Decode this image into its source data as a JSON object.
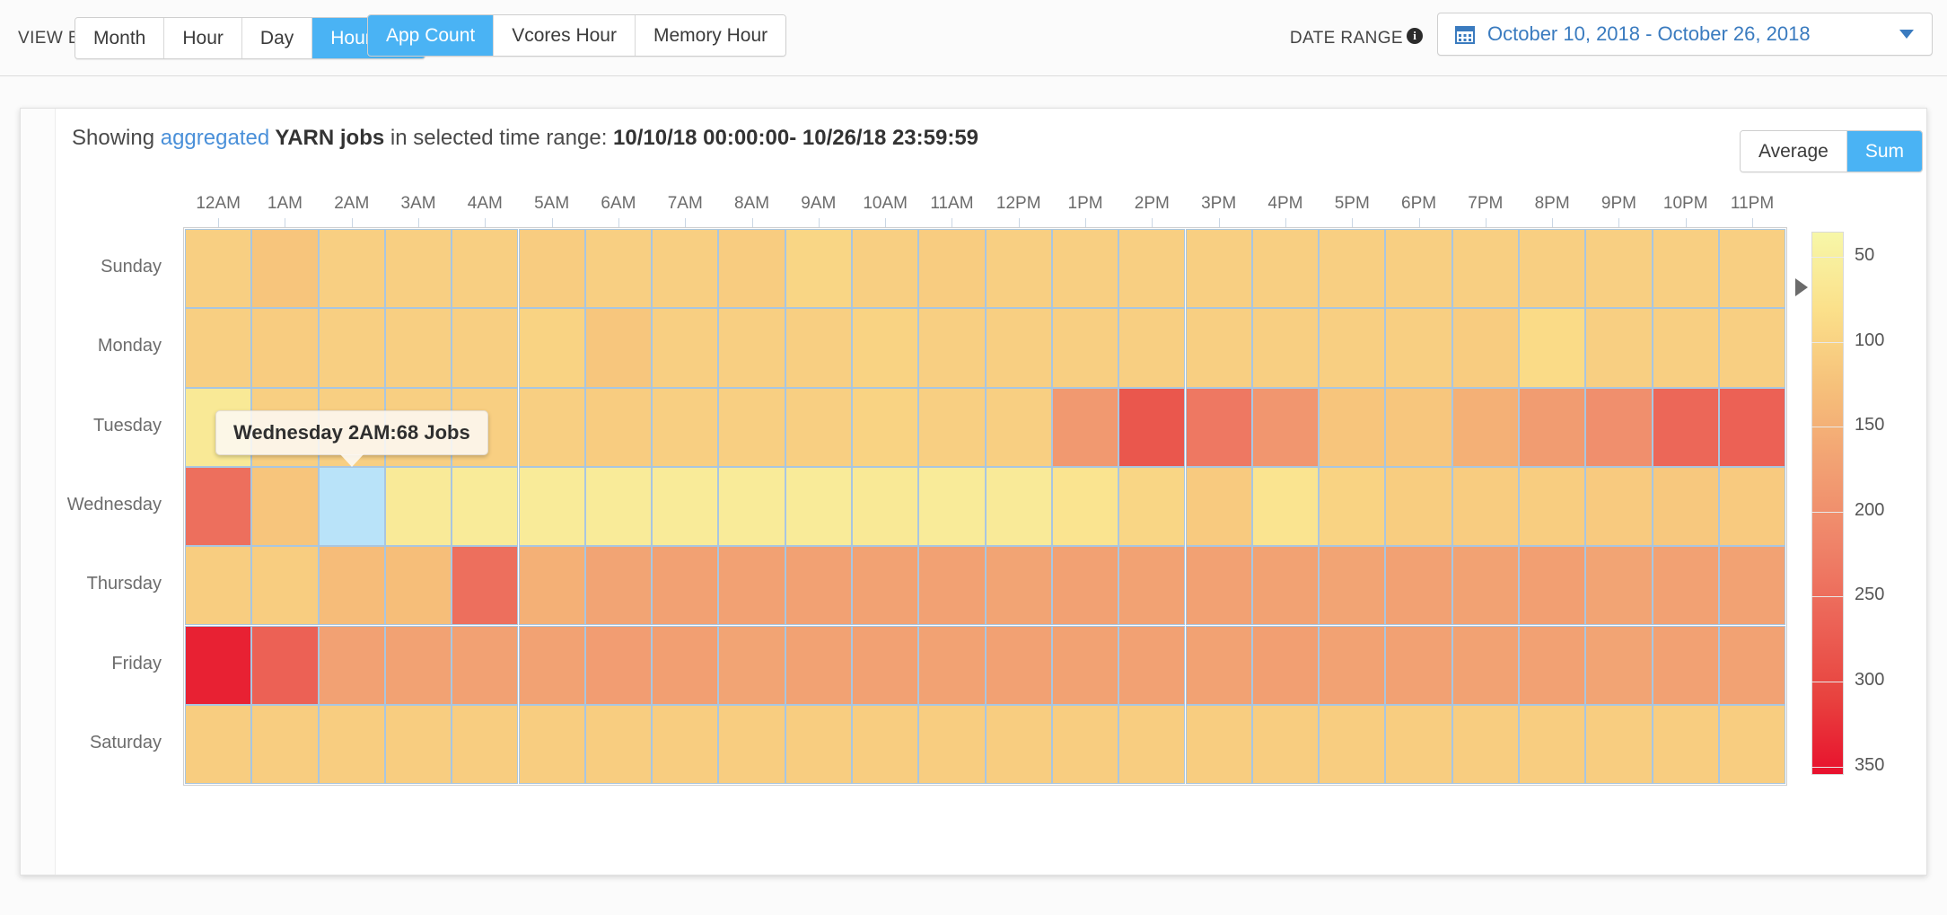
{
  "toolbar": {
    "view_by_label": "VIEW BY",
    "view_by_options": [
      "Month",
      "Hour",
      "Day",
      "Hour/day"
    ],
    "view_by_selected": "Hour/day",
    "metric_options": [
      "App Count",
      "Vcores Hour",
      "Memory Hour"
    ],
    "metric_selected": "App Count",
    "date_range_label": "DATE RANGE",
    "date_range_value": "October 10, 2018 - October 26, 2018",
    "info_icon": "info-icon",
    "calendar_icon": "calendar-icon",
    "caret_icon": "chevron-down-icon"
  },
  "card": {
    "title_prefix": "Showing ",
    "title_link": "aggregated",
    "title_entity": " YARN jobs",
    "title_middle": " in selected time range: ",
    "title_range": "10/10/18 00:00:00- 10/26/18 23:59:59",
    "aggregation_options": [
      "Average",
      "Sum"
    ],
    "aggregation_selected": "Sum"
  },
  "tooltip": {
    "text": "Wednesday 2AM:68 Jobs",
    "day": "Wednesday",
    "hour": "2AM",
    "value": 68,
    "unit": "Jobs"
  },
  "chart_data": {
    "type": "heatmap",
    "title": "Showing aggregated YARN jobs in selected time range: 10/10/18 00:00:00- 10/26/18 23:59:59",
    "xlabel": "",
    "ylabel": "",
    "metric": "App Count",
    "aggregation": "Sum",
    "grid": true,
    "legend_position": "right",
    "categories_x": [
      "12AM",
      "1AM",
      "2AM",
      "3AM",
      "4AM",
      "5AM",
      "6AM",
      "7AM",
      "8AM",
      "9AM",
      "10AM",
      "11AM",
      "12PM",
      "1PM",
      "2PM",
      "3PM",
      "4PM",
      "5PM",
      "6PM",
      "7PM",
      "8PM",
      "9PM",
      "10PM",
      "11PM"
    ],
    "categories_y": [
      "Sunday",
      "Monday",
      "Tuesday",
      "Wednesday",
      "Thursday",
      "Friday",
      "Saturday"
    ],
    "colorbar": {
      "ticks": [
        50,
        100,
        150,
        200,
        250,
        300,
        350
      ],
      "vmin": 35,
      "vmax": 355,
      "marker_value": 68,
      "colors_low_to_high": [
        "#f7f7a8",
        "#fbe08a",
        "#f6c07a",
        "#f2a173",
        "#ef8469",
        "#ec6457",
        "#e8433f",
        "#e8112d"
      ]
    },
    "highlight": {
      "day": "Wednesday",
      "hour": "2AM",
      "color": "#b9e3f9"
    },
    "values": [
      [
        105,
        120,
        105,
        105,
        105,
        110,
        105,
        105,
        110,
        95,
        105,
        110,
        105,
        105,
        105,
        105,
        105,
        105,
        105,
        105,
        105,
        105,
        105,
        105
      ],
      [
        105,
        110,
        105,
        105,
        105,
        100,
        118,
        105,
        105,
        105,
        100,
        105,
        105,
        105,
        105,
        105,
        105,
        105,
        105,
        110,
        88,
        105,
        105,
        105
      ],
      [
        62,
        105,
        105,
        105,
        105,
        105,
        110,
        105,
        105,
        105,
        100,
        105,
        105,
        185,
        282,
        235,
        190,
        120,
        118,
        150,
        180,
        200,
        260,
        268
      ],
      [
        248,
        120,
        68,
        60,
        58,
        58,
        58,
        58,
        58,
        58,
        62,
        58,
        60,
        72,
        95,
        112,
        72,
        100,
        108,
        110,
        108,
        112,
        115,
        112
      ],
      [
        108,
        108,
        132,
        130,
        248,
        150,
        168,
        172,
        172,
        172,
        170,
        172,
        168,
        172,
        170,
        172,
        170,
        168,
        172,
        170,
        175,
        168,
        172,
        170
      ],
      [
        340,
        268,
        172,
        170,
        172,
        170,
        178,
        176,
        168,
        170,
        172,
        170,
        172,
        170,
        172,
        170,
        175,
        170,
        172,
        170,
        172,
        168,
        172,
        170
      ],
      [
        108,
        108,
        108,
        108,
        108,
        108,
        108,
        108,
        108,
        108,
        108,
        108,
        108,
        108,
        108,
        108,
        108,
        108,
        108,
        108,
        108,
        108,
        108,
        108
      ]
    ]
  }
}
